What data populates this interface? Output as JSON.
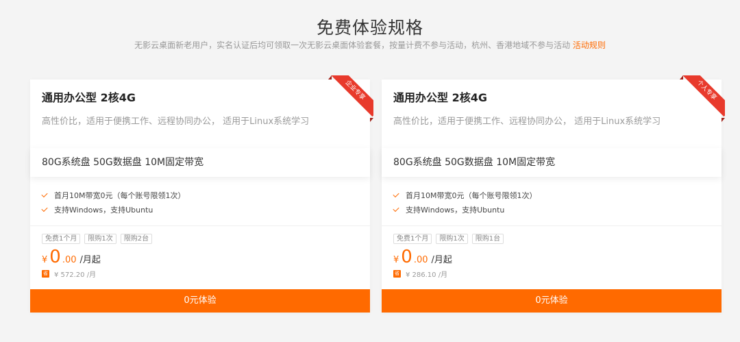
{
  "header": {
    "title": "免费体验规格",
    "subtitle": "无影云桌面新老用户，实名认证后均可领取一次无影云桌面体验套餐，按量计费不参与活动，杭州、香港地域不参与活动",
    "rules_link": "活动规则"
  },
  "cards": [
    {
      "name": "通用办公型 2核4G",
      "ribbon": "企业专享",
      "desc": "高性价比，适用于便携工作、远程协同办公， 适用于Linux系统学习",
      "spec": "80G系统盘 50G数据盘 10M固定带宽",
      "features": [
        "首月10M带宽0元（每个账号限领1次）",
        "支持Windows，支持Ubuntu"
      ],
      "tags": [
        "免费1个月",
        "限购1次",
        "限购2台"
      ],
      "price_symbol": "¥",
      "price_int": "0",
      "price_dec": ".00",
      "price_unit": "/月起",
      "save_icon": "省",
      "original_price": "¥ 572.20 /月",
      "cta": "0元体验"
    },
    {
      "name": "通用办公型 2核4G",
      "ribbon": "个人专享",
      "desc": "高性价比，适用于便携工作、远程协同办公， 适用于Linux系统学习",
      "spec": "80G系统盘 50G数据盘 10M固定带宽",
      "features": [
        "首月10M带宽0元（每个账号限领1次）",
        "支持Windows，支持Ubuntu"
      ],
      "tags": [
        "免费1个月",
        "限购1次",
        "限购1台"
      ],
      "price_symbol": "¥",
      "price_int": "0",
      "price_dec": ".00",
      "price_unit": "/月起",
      "save_icon": "省",
      "original_price": "¥ 286.10 /月",
      "cta": "0元体验"
    }
  ],
  "colors": {
    "accent": "#ff6a00",
    "ribbon": "#e83a2c"
  }
}
